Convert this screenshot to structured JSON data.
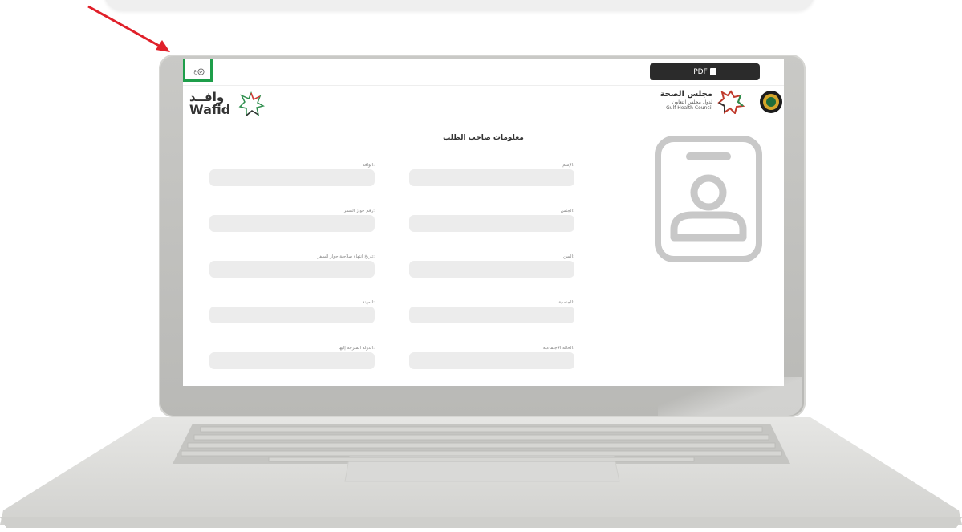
{
  "toolbar": {
    "lang_label": "ع",
    "pdf_label": "PDF"
  },
  "branding": {
    "wafid_ar": "وافــد",
    "wafid_en": "Wafid",
    "ghc_ar": "مجلس الصحة",
    "ghc_ar_sub": "لدول مجلس التعاون",
    "ghc_en": "Gulf Health Council"
  },
  "form": {
    "title": "معلومات صاحب الطلب",
    "fields": [
      {
        "label": "الإسم:"
      },
      {
        "label": "الوافد:"
      },
      {
        "label": "الجنس:"
      },
      {
        "label": "رقم جواز السفر:"
      },
      {
        "label": "السن:"
      },
      {
        "label": "تاريخ انتهاء صلاحية جواز السفر:"
      },
      {
        "label": "الجنسية:"
      },
      {
        "label": "المهنة:"
      },
      {
        "label": "الحالة الاجتماعية:"
      },
      {
        "label": "الدولة المترجه إليها:"
      }
    ]
  },
  "colors": {
    "highlight": "#1e9e4a",
    "arrow": "#e0202a",
    "pdf_button": "#2b2b2b",
    "field_bg": "#ececec"
  },
  "icons": {
    "avatar": "id-badge-icon",
    "lang": "globe-icon",
    "pdf": "document-icon"
  }
}
